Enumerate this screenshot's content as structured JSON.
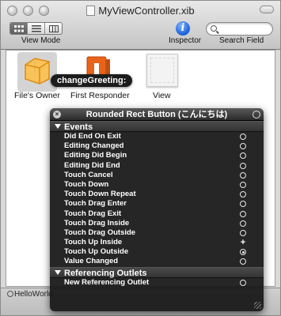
{
  "window": {
    "title": "MyViewController.xib"
  },
  "toolbar": {
    "view_mode_label": "View Mode",
    "inspector_label": "Inspector",
    "search_field_label": "Search Field",
    "search_placeholder": ""
  },
  "objects": [
    {
      "label": "File's Owner"
    },
    {
      "label": "First Responder"
    },
    {
      "label": "View"
    }
  ],
  "tooltip": {
    "text": "changeGreeting:"
  },
  "hud": {
    "title": "Rounded Rect Button (こんにちは)",
    "events_header": "Events",
    "events": [
      {
        "label": "Did End On Exit",
        "state": "open"
      },
      {
        "label": "Editing Changed",
        "state": "open"
      },
      {
        "label": "Editing Did Begin",
        "state": "open"
      },
      {
        "label": "Editing Did End",
        "state": "open"
      },
      {
        "label": "Touch Cancel",
        "state": "open"
      },
      {
        "label": "Touch Down",
        "state": "open"
      },
      {
        "label": "Touch Down Repeat",
        "state": "open"
      },
      {
        "label": "Touch Drag Enter",
        "state": "open"
      },
      {
        "label": "Touch Drag Exit",
        "state": "open"
      },
      {
        "label": "Touch Drag Inside",
        "state": "open"
      },
      {
        "label": "Touch Drag Outside",
        "state": "open"
      },
      {
        "label": "Touch Up Inside",
        "state": "connected"
      },
      {
        "label": "Touch Up Outside",
        "state": "linked"
      },
      {
        "label": "Value Changed",
        "state": "open"
      }
    ],
    "outlets_header": "Referencing Outlets",
    "outlets": [
      {
        "label": "New Referencing Outlet",
        "state": "open"
      }
    ]
  },
  "statusbar": {
    "text": "HelloWorld"
  },
  "colors": {
    "hud_bg": "#161616",
    "accent_blue": "#1a5fd9",
    "cube_orange": "#f0a020",
    "responder_orange": "#e8641a"
  }
}
